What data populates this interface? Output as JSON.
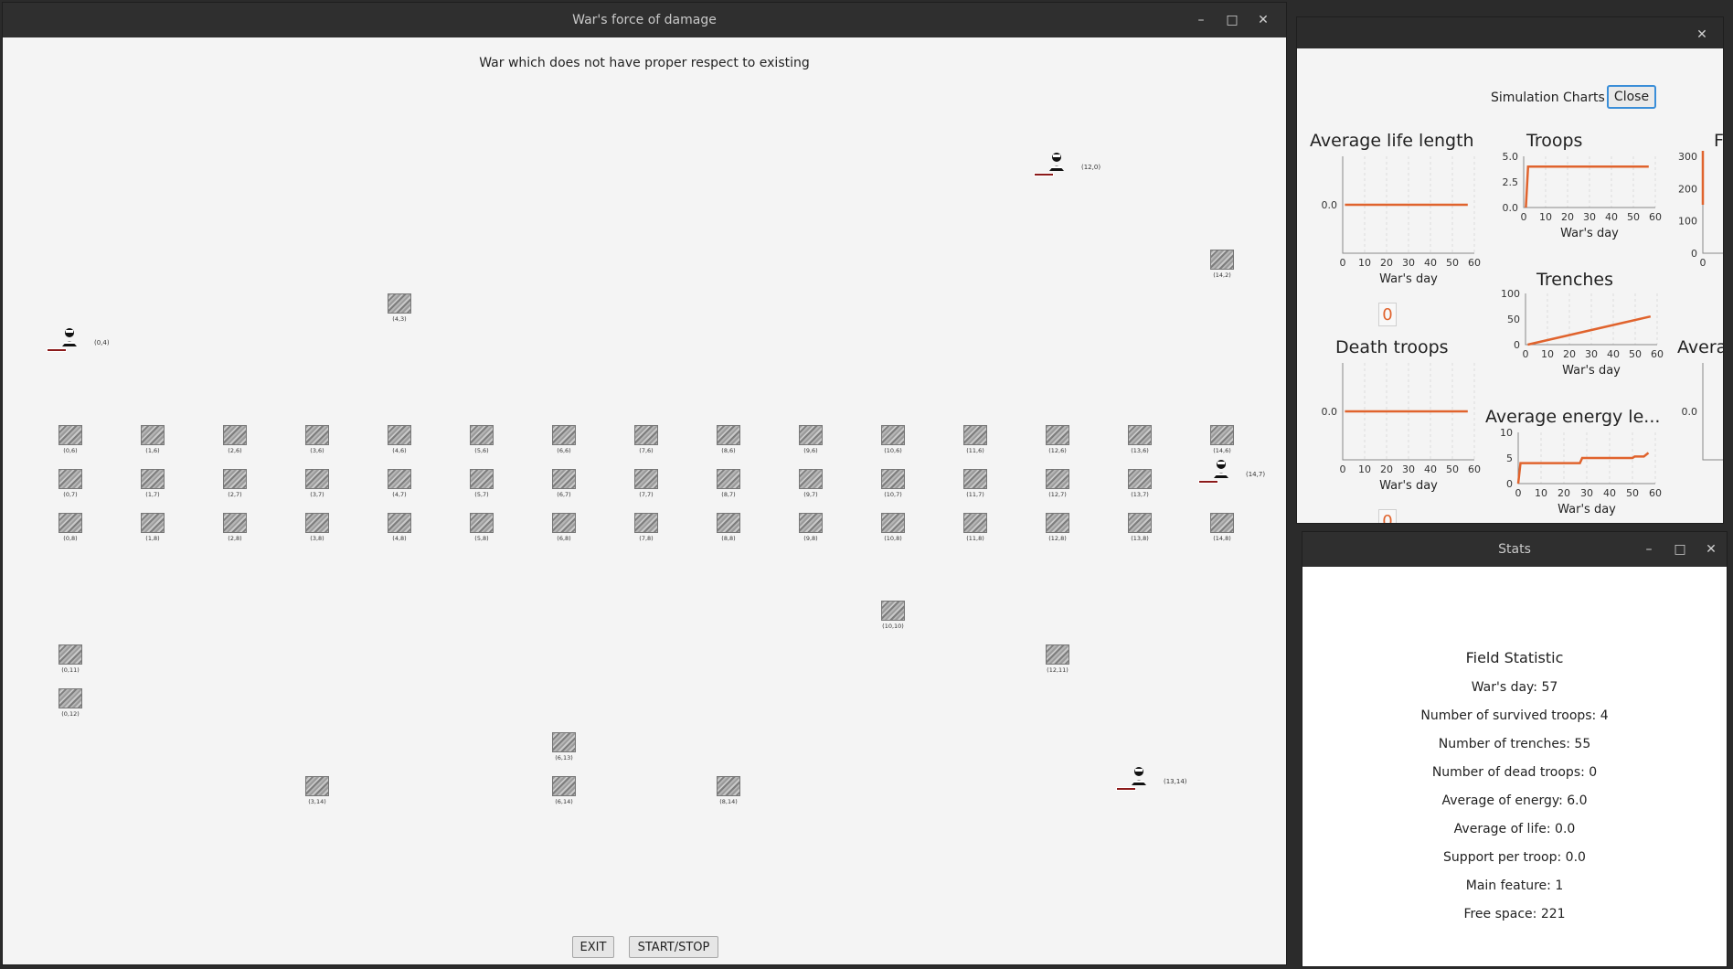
{
  "main_window": {
    "title": "War's force of damage",
    "subtitle": "War which does not have proper respect to existing",
    "buttons": {
      "exit": "EXIT",
      "start_stop": "START/STOP"
    },
    "trench_labels": [
      "(12,0)",
      "(14,2)",
      "(4,3)",
      "(0,4)",
      "(0,6)",
      "(1,6)",
      "(2,6)",
      "(3,6)",
      "(4,6)",
      "(5,6)",
      "(6,6)",
      "(7,6)",
      "(8,6)",
      "(9,6)",
      "(10,6)",
      "(11,6)",
      "(12,6)",
      "(13,6)",
      "(14,6)",
      "(0,7)",
      "(1,7)",
      "(2,7)",
      "(3,7)",
      "(4,7)",
      "(5,7)",
      "(6,7)",
      "(7,7)",
      "(8,7)",
      "(9,7)",
      "(10,7)",
      "(11,7)",
      "(12,7)",
      "(13,7)",
      "(14,7)",
      "(0,8)",
      "(1,8)",
      "(2,8)",
      "(3,8)",
      "(4,8)",
      "(5,8)",
      "(6,8)",
      "(7,8)",
      "(8,8)",
      "(9,8)",
      "(10,8)",
      "(11,8)",
      "(12,8)",
      "(13,8)",
      "(14,8)",
      "(10,10)",
      "(0,11)",
      "(12,11)",
      "(0,12)",
      "(6,13)",
      "(3,14)",
      "(6,14)",
      "(8,14)",
      "(13,14)"
    ]
  },
  "charts_window": {
    "label": "Simulation Charts",
    "close_label": "Close",
    "titles": {
      "avg_life": "Average life length",
      "troops": "Troops",
      "third": "F",
      "trenches": "Trenches",
      "death_troops": "Death troops",
      "avg_energy": "Average energy le...",
      "avera": "Avera"
    },
    "xlabel": "War's day",
    "counter_1": "0",
    "counter_2": "0"
  },
  "chart_data": [
    {
      "type": "line",
      "title": "Average life length",
      "xlabel": "War's day",
      "xlim": [
        0,
        60
      ],
      "x_ticks": [
        "0",
        "10",
        "20",
        "30",
        "40",
        "50",
        "60"
      ],
      "y_ticks": [
        "0.0"
      ],
      "x": [
        1,
        57
      ],
      "y": [
        0,
        0
      ]
    },
    {
      "type": "line",
      "title": "Troops",
      "xlabel": "War's day",
      "xlim": [
        0,
        60
      ],
      "ylim": [
        0,
        5
      ],
      "x_ticks": [
        "0",
        "10",
        "20",
        "30",
        "40",
        "50",
        "60"
      ],
      "y_ticks": [
        "0.0",
        "2.5",
        "5.0"
      ],
      "x": [
        1,
        2,
        57
      ],
      "y": [
        0,
        4,
        4
      ]
    },
    {
      "type": "line",
      "title": "Trenches",
      "xlabel": "War's day",
      "xlim": [
        0,
        60
      ],
      "ylim": [
        0,
        100
      ],
      "x_ticks": [
        "0",
        "10",
        "20",
        "30",
        "40",
        "50",
        "60"
      ],
      "y_ticks": [
        "0",
        "50",
        "100"
      ],
      "x": [
        1,
        57
      ],
      "y": [
        0,
        55
      ]
    },
    {
      "type": "line",
      "title": "Death troops",
      "xlabel": "War's day",
      "xlim": [
        0,
        60
      ],
      "x_ticks": [
        "0",
        "10",
        "20",
        "30",
        "40",
        "50",
        "60"
      ],
      "y_ticks": [
        "0.0"
      ],
      "x": [
        1,
        57
      ],
      "y": [
        0,
        0
      ]
    },
    {
      "type": "line",
      "title": "Average energy le...",
      "xlabel": "War's day",
      "xlim": [
        0,
        60
      ],
      "ylim": [
        0,
        10
      ],
      "x_ticks": [
        "0",
        "10",
        "20",
        "30",
        "40",
        "50",
        "60"
      ],
      "y_ticks": [
        "0",
        "5",
        "10"
      ],
      "x": [
        0,
        1,
        27,
        28,
        50,
        51,
        55,
        57
      ],
      "y": [
        0,
        4,
        4,
        5,
        5,
        5.3,
        5.3,
        6
      ]
    },
    {
      "type": "line",
      "title": "F",
      "y_ticks": [
        "0",
        "100",
        "200",
        "300"
      ],
      "x_ticks": [
        "0"
      ],
      "x": [
        0,
        1,
        2
      ],
      "y": [
        0,
        221,
        221
      ]
    },
    {
      "type": "line",
      "title": "Avera",
      "y_ticks": [
        "0.0"
      ],
      "x": [],
      "y": []
    }
  ],
  "stats_window": {
    "title": "Stats",
    "heading": "Field Statistic",
    "lines": [
      "War's day: 57",
      "Number of survived troops: 4",
      "Number of trenches: 55",
      "Number of dead troops: 0",
      "Average of energy: 6.0",
      "Average of life: 0.0",
      "Support per troop: 0.0",
      "Main feature: 1",
      "Free space: 221"
    ]
  },
  "colors": {
    "series": "#e0632d",
    "focus": "#3a8ed8",
    "health": "#8b1a1a"
  },
  "icons": {
    "window_min": "minimize-icon",
    "window_max": "maximize-icon",
    "window_close": "close-icon",
    "troop": "soldier-icon",
    "trench": "trench-icon"
  }
}
